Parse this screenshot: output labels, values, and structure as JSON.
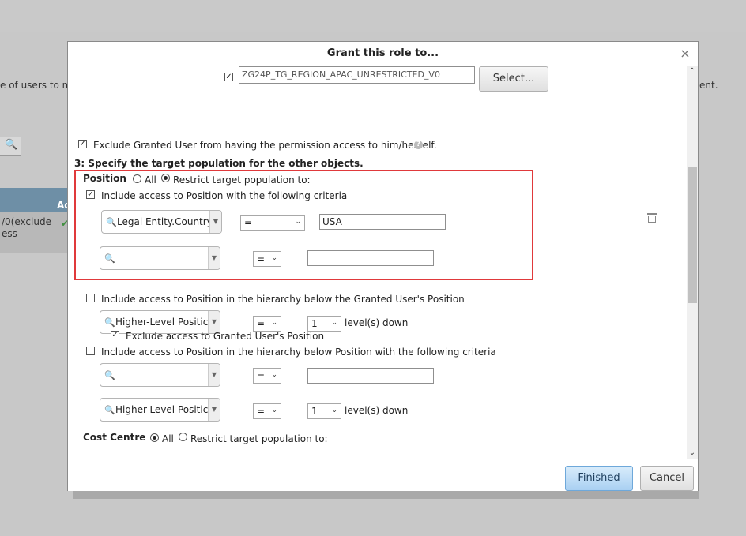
{
  "background": {
    "left_text": "e of users to ma",
    "right_text": "ent.",
    "table_head": "Ad",
    "table_row_line1": "/0(exclude",
    "table_row_line2": "ess"
  },
  "dialog": {
    "title": "Grant this role to...",
    "close": "×",
    "group_value": "ZG24P_TG_REGION_APAC_UNRESTRICTED_V0",
    "select_button": "Select...",
    "exclude_granted_label": "Exclude Granted User from having the permission access to him/herself.",
    "section3_label": "3: Specify the target population for the other objects.",
    "position": {
      "label": "Position",
      "all_label": "All",
      "restrict_label": "Restrict target population to:",
      "criteria_label": "Include access to Position with the following criteria",
      "row1": {
        "field": "Legal Entity.Country.",
        "operator": "=",
        "value": "USA"
      },
      "row2": {
        "field": "",
        "operator": "=",
        "value": ""
      },
      "hierarchy_granted_label": "Include access to Position in the hierarchy below the Granted User's Position",
      "hierarchy_granted_field": "Higher-Level Positic",
      "hierarchy_granted_operator": "=",
      "hierarchy_granted_levels": "1",
      "levels_down_label": "level(s) down",
      "exclude_access_label": "Exclude access to Granted User's Position",
      "hierarchy_criteria_label": "Include access to Position in the hierarchy below Position with the following criteria",
      "hc_row1": {
        "field": "",
        "operator": "=",
        "value": ""
      },
      "hc_row2": {
        "field": "Higher-Level Positic",
        "operator": "=",
        "levels": "1"
      }
    },
    "cost_centre": {
      "label": "Cost Centre",
      "all_label": "All",
      "restrict_label": "Restrict target population to:"
    },
    "finished_button": "Finished",
    "cancel_button": "Cancel"
  }
}
